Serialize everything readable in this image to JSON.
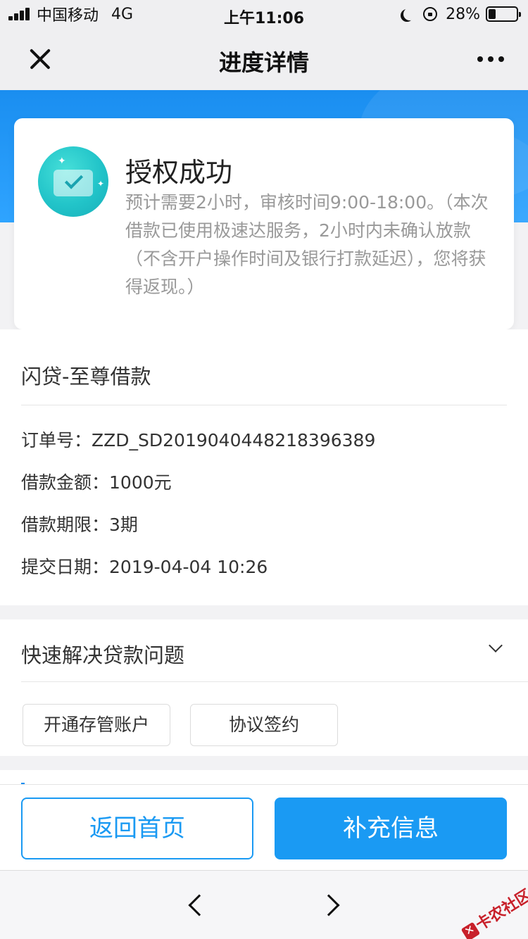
{
  "status_bar": {
    "carrier": "中国移动",
    "network": "4G",
    "time": "上午11:06",
    "battery": "28%"
  },
  "nav": {
    "title": "进度详情"
  },
  "success": {
    "title": "授权成功",
    "description": "预计需要2小时，审核时间9:00-18:00。（本次借款已使用极速达服务，2小时内未确认放款（不含开户操作时间及银行打款延迟），您将获得返现。）"
  },
  "loan": {
    "product_name": "闪贷-至尊借款",
    "order_label": "订单号：",
    "order_value": "ZZD_SD2019040448218396389",
    "amount_label": "借款金额：",
    "amount_value": "1000元",
    "term_label": "借款期限：",
    "term_value": "3期",
    "date_label": "提交日期：",
    "date_value": "2019-04-04 10:26"
  },
  "help": {
    "title": "快速解决贷款问题",
    "buttons": [
      "开通存管账户",
      "协议签约"
    ]
  },
  "actions": {
    "home_label": "返回首页",
    "supplement_label": "补充信息"
  },
  "watermark": {
    "text": "卡农社区"
  },
  "colors": {
    "accent": "#1a9af3",
    "header_blue": "#1a8ef0",
    "success_teal": "#22c4c9"
  }
}
